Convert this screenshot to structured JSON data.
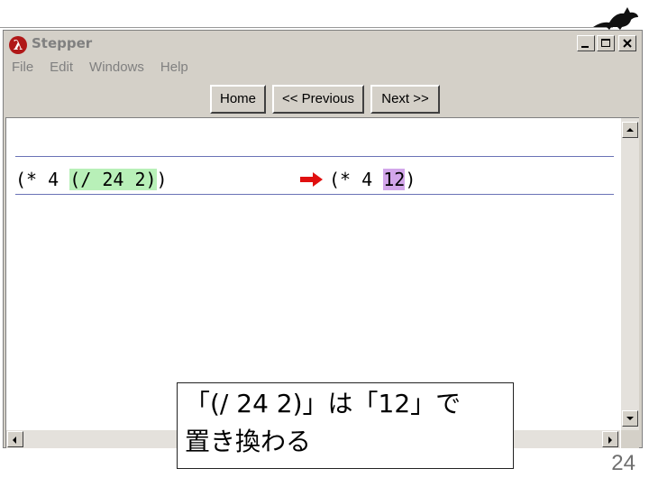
{
  "window": {
    "title": "Stepper",
    "app_icon": "λ"
  },
  "menu": [
    "File",
    "Edit",
    "Windows",
    "Help"
  ],
  "toolbar": {
    "home_label": "Home",
    "previous_label": "<< Previous",
    "next_label": "Next >>"
  },
  "stepper": {
    "before": {
      "prefix": "(* 4 ",
      "highlight": "(/ 24 2)",
      "suffix": ")"
    },
    "after": {
      "prefix": "(* 4 ",
      "highlight": "12",
      "suffix": ")"
    }
  },
  "callout": {
    "line1": "「(/ 24 2)」は「12」で",
    "line2": "置き換わる"
  },
  "slide": {
    "page_number": "24"
  },
  "colors": {
    "redex_highlight": "#b8f0b8",
    "result_highlight": "#d2a6ea",
    "arrow": "#e01010",
    "separator_line": "#6a73b6"
  },
  "icons": {
    "app": "lambda-icon",
    "arrow": "right-arrow-icon",
    "logo": "cat-silhouette-icon"
  }
}
